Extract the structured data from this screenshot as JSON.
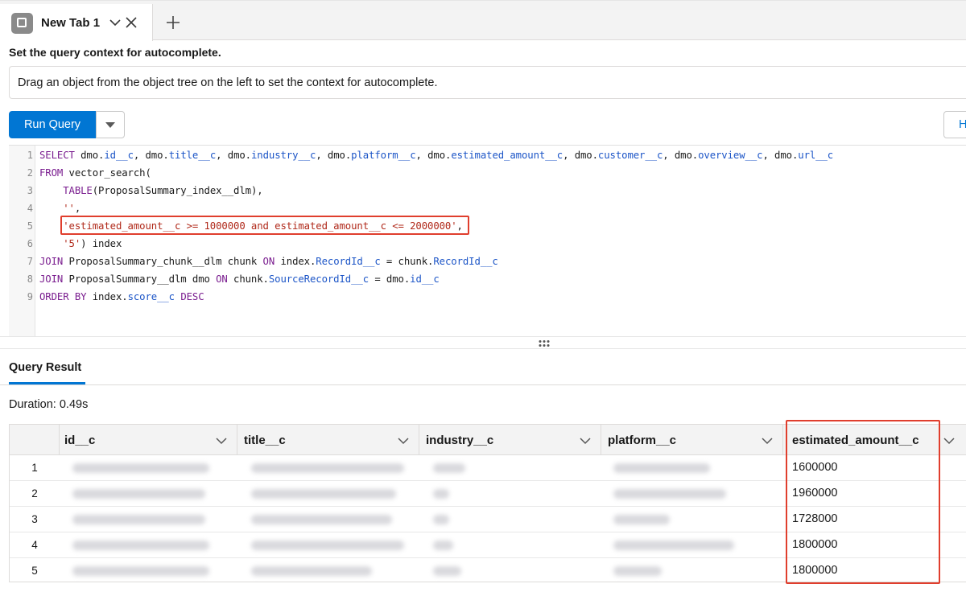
{
  "tab": {
    "label": "New Tab 1"
  },
  "context": {
    "label": "Set the query context for autocomplete.",
    "hint": "Drag an object from the object tree on the left to set the context for autocomplete."
  },
  "toolbar": {
    "run_label": "Run Query",
    "help_label": "H"
  },
  "editor": {
    "line_numbers": [
      "1",
      "2",
      "3",
      "4",
      "5",
      "6",
      "7",
      "8",
      "9"
    ],
    "highlighted_line": "5"
  },
  "results": {
    "tab_label": "Query Result",
    "duration": "Duration: 0.49s",
    "columns": [
      "id__c",
      "title__c",
      "industry__c",
      "platform__c",
      "estimated_amount__c"
    ],
    "rows": [
      {
        "num": "1",
        "estimated_amount": "1600000"
      },
      {
        "num": "2",
        "estimated_amount": "1960000"
      },
      {
        "num": "3",
        "estimated_amount": "1728000"
      },
      {
        "num": "4",
        "estimated_amount": "1800000"
      },
      {
        "num": "5",
        "estimated_amount": "1800000"
      }
    ]
  },
  "colors": {
    "accent": "#0176d3",
    "highlight": "#e03e2d",
    "keyword": "#7a1d8f",
    "field": "#1c55c7",
    "string": "#b0291a"
  },
  "icons": [
    "tab-page-icon",
    "chevron-down-icon",
    "close-icon",
    "plus-icon",
    "caret-down-icon",
    "drag-handle-icon"
  ]
}
